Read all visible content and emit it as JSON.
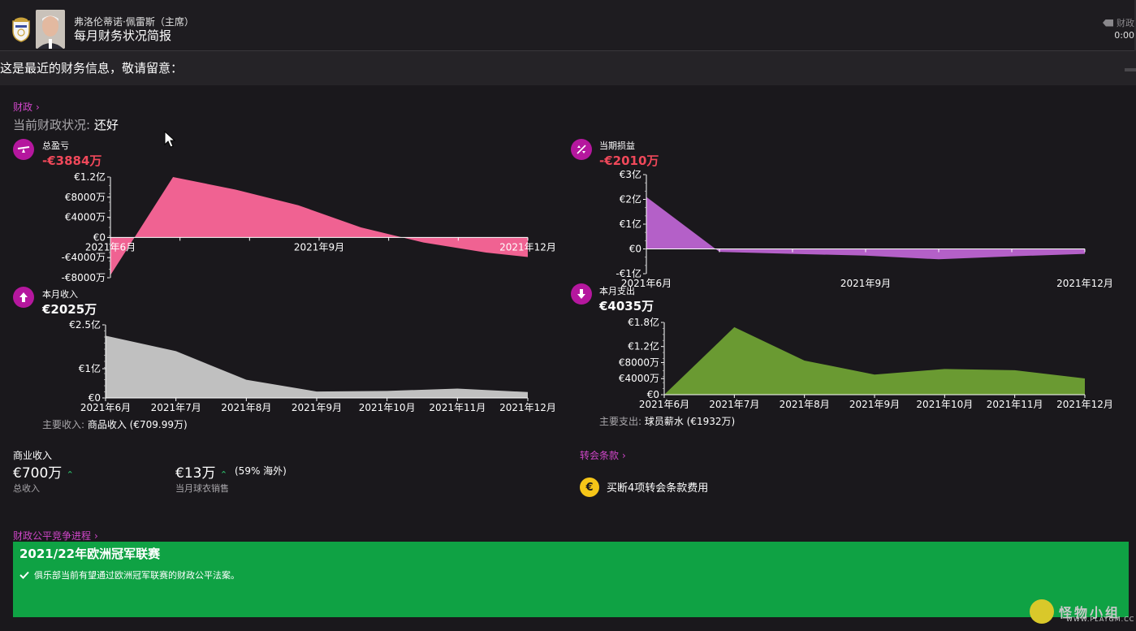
{
  "header": {
    "sender": "弗洛伦蒂诺·佩雷斯（主席）",
    "subject": "每月财务状况简报",
    "category": "财政",
    "time": "0:00"
  },
  "intro": "这是最近的财务信息，敬请留意：",
  "finance": {
    "link_label": "财政",
    "status_label": "当前财政状况: ",
    "status_value": "还好"
  },
  "metrics": {
    "total_profit": {
      "label": "总盈亏",
      "value": "-€3884万",
      "icon": "scale-icon"
    },
    "period_profit": {
      "label": "当期损益",
      "value": "-€2010万",
      "icon": "percent-icon"
    },
    "monthly_income": {
      "label": "本月收入",
      "value": "€2025万",
      "icon": "arrow-up-icon"
    },
    "monthly_expense": {
      "label": "本月支出",
      "value": "€4035万",
      "icon": "arrow-down-icon"
    }
  },
  "chart_data": [
    {
      "id": "total_profit",
      "type": "area",
      "y_unit": "万欧元",
      "x_tick_labels": [
        "2021年6月",
        "2021年9月",
        "2021年12月"
      ],
      "y_tick_labels": [
        "€1.2亿",
        "€8000万",
        "€4000万",
        "€0",
        "-€4000万",
        "-€8000万"
      ],
      "y_ticks": [
        12000,
        8000,
        4000,
        0,
        -4000,
        -8000
      ],
      "ylim": [
        -8000,
        12000
      ],
      "x": [
        0,
        0.9,
        1.8,
        2.7,
        3.6,
        4.5,
        5.4,
        6.0
      ],
      "values": [
        -7500,
        12000,
        9500,
        6400,
        2000,
        -1000,
        -3000,
        -3884
      ],
      "color": "#f06292"
    },
    {
      "id": "period_profit",
      "type": "area",
      "y_unit": "亿欧元",
      "x_tick_labels": [
        "2021年6月",
        "2021年9月",
        "2021年12月"
      ],
      "y_tick_labels": [
        "€3亿",
        "€2亿",
        "€1亿",
        "€0",
        "-€1亿"
      ],
      "y_ticks": [
        3,
        2,
        1,
        0,
        -1
      ],
      "ylim": [
        -1,
        3
      ],
      "x": [
        0,
        1,
        2,
        3,
        4,
        5,
        6
      ],
      "values": [
        2.1,
        -0.12,
        -0.2,
        -0.27,
        -0.42,
        -0.3,
        -0.2
      ],
      "color": "#b460c8"
    },
    {
      "id": "monthly_income",
      "type": "area",
      "y_unit": "亿欧元",
      "x_tick_labels": [
        "2021年6月",
        "2021年7月",
        "2021年8月",
        "2021年9月",
        "2021年10月",
        "2021年11月",
        "2021年12月"
      ],
      "y_tick_labels": [
        "€2.5亿",
        "€1亿",
        "€0"
      ],
      "y_ticks": [
        2.5,
        1,
        0
      ],
      "ylim": [
        0,
        2.5
      ],
      "x": [
        0,
        1,
        2,
        3,
        4,
        5,
        6
      ],
      "values": [
        2.13,
        1.6,
        0.62,
        0.22,
        0.24,
        0.32,
        0.2
      ],
      "color": "#c0c0c0"
    },
    {
      "id": "monthly_expense",
      "type": "area",
      "y_unit": "万欧元",
      "x_tick_labels": [
        "2021年6月",
        "2021年7月",
        "2021年8月",
        "2021年9月",
        "2021年10月",
        "2021年11月",
        "2021年12月"
      ],
      "y_tick_labels": [
        "€1.8亿",
        "€1.2亿",
        "€8000万",
        "€4000万",
        "€0"
      ],
      "y_ticks": [
        18000,
        12000,
        8000,
        4000,
        0
      ],
      "ylim": [
        0,
        18000
      ],
      "x": [
        0,
        1,
        2,
        3,
        4,
        5,
        6
      ],
      "values": [
        0,
        16800,
        8500,
        5000,
        6400,
        6100,
        4035
      ],
      "color": "#6a9a32"
    }
  ],
  "income_note": {
    "label": "主要收入: ",
    "value": "商品收入 (€709.99万)"
  },
  "expense_note": {
    "label": "主要支出: ",
    "value": "球员薪水 (€1932万)"
  },
  "commercial": {
    "title": "商业收入",
    "total_value": "€700万",
    "total_label": "总收入",
    "shirt_value": "€13万",
    "shirt_pct": "(59% 海外)",
    "shirt_label": "当月球衣销售",
    "trend": "up"
  },
  "transfer": {
    "link_label": "转会条款",
    "clause_text": "买断4项转会条款费用",
    "coin_symbol": "€"
  },
  "ffp": {
    "link_label": "财政公平竞争进程",
    "title": "2021/22年欧洲冠军联赛",
    "message": "俱乐部当前有望通过欧洲冠军联赛的财政公平法案。",
    "color": "#0fa244"
  },
  "watermark": {
    "text": "怪物小组",
    "url": "WWW.PLAYGM.CC"
  },
  "colors": {
    "accent": "#cf46c8",
    "negative": "#f0485a",
    "panel": "#1a181c"
  }
}
